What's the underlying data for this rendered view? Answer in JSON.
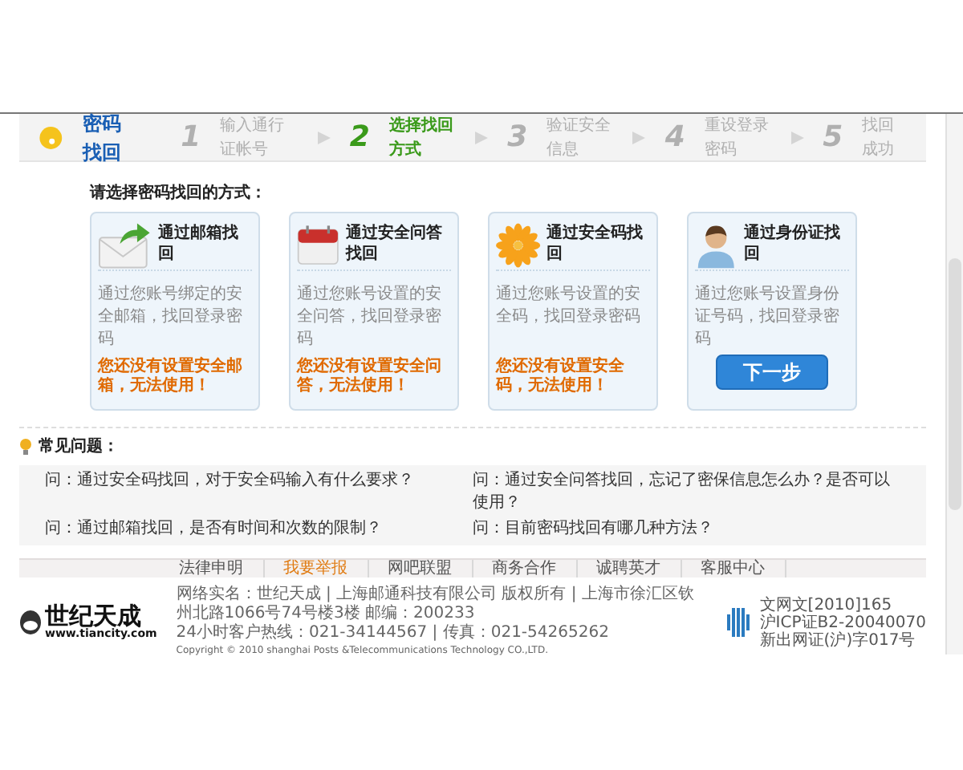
{
  "header": {
    "title": "密码找回",
    "steps": [
      {
        "number": "1",
        "label": "输入通行证帐号",
        "selected": false
      },
      {
        "number": "2",
        "label": "选择找回方式",
        "selected": true
      },
      {
        "number": "3",
        "label": "验证安全信息",
        "selected": false
      },
      {
        "number": "4",
        "label": "重设登录密码",
        "selected": false
      },
      {
        "number": "5",
        "label": "找回成功",
        "selected": false
      }
    ]
  },
  "prompt": "请选择密码找回的方式：",
  "methods": [
    {
      "kind": "email",
      "title": "通过邮箱找回",
      "description": "通过您账号绑定的安全邮箱，找回登录密码",
      "warning": "您还没有设置安全邮箱，无法使用！"
    },
    {
      "kind": "question",
      "title": "通过安全问答找回",
      "description": "通过您账号设置的安全问答，找回登录密码",
      "warning": "您还没有设置安全问答，无法使用！"
    },
    {
      "kind": "code",
      "title": "通过安全码找回",
      "description": "通过您账号设置的安全码，找回登录密码",
      "warning": "您还没有设置安全码，无法使用！"
    },
    {
      "kind": "id",
      "title": "通过身份证找回",
      "description": "通过您账号设置身份证号码，找回登录密码",
      "button": "下一步"
    }
  ],
  "faq": {
    "title": "常见问题：",
    "questions": [
      "问：通过安全码找回，对于安全码输入有什么要求？",
      "问：通过安全问答找回，忘记了密保信息怎么办？是否可以使用？",
      "问：通过邮箱找回，是否有时间和次数的限制？",
      "问：目前密码找回有哪几种方法？"
    ]
  },
  "footer": {
    "links": [
      {
        "label": "法律申明",
        "selected": false
      },
      {
        "label": "我要举报",
        "selected": true
      },
      {
        "label": "网吧联盟",
        "selected": false
      },
      {
        "label": "商务合作",
        "selected": false
      },
      {
        "label": "诚聘英才",
        "selected": false
      },
      {
        "label": "客服中心",
        "selected": false
      }
    ],
    "logo": {
      "name": "世纪天成",
      "url": "www.tiancity.com"
    },
    "info_lines": [
      "网络实名：世纪天成 | 上海邮通科技有限公司 版权所有 | 上海市徐汇区钦州北路1066号74号楼3楼 邮编：200233",
      "24小时客户热线：021-34144567 | 传真：021-54265262"
    ],
    "copyright": "Copyright © 2010 shanghai Posts &Telecommunications Technology CO.,LTD.",
    "licenses": [
      "文网文[2010]165",
      "沪ICP证B2-20040070",
      "新出网证(沪)字017号"
    ]
  }
}
